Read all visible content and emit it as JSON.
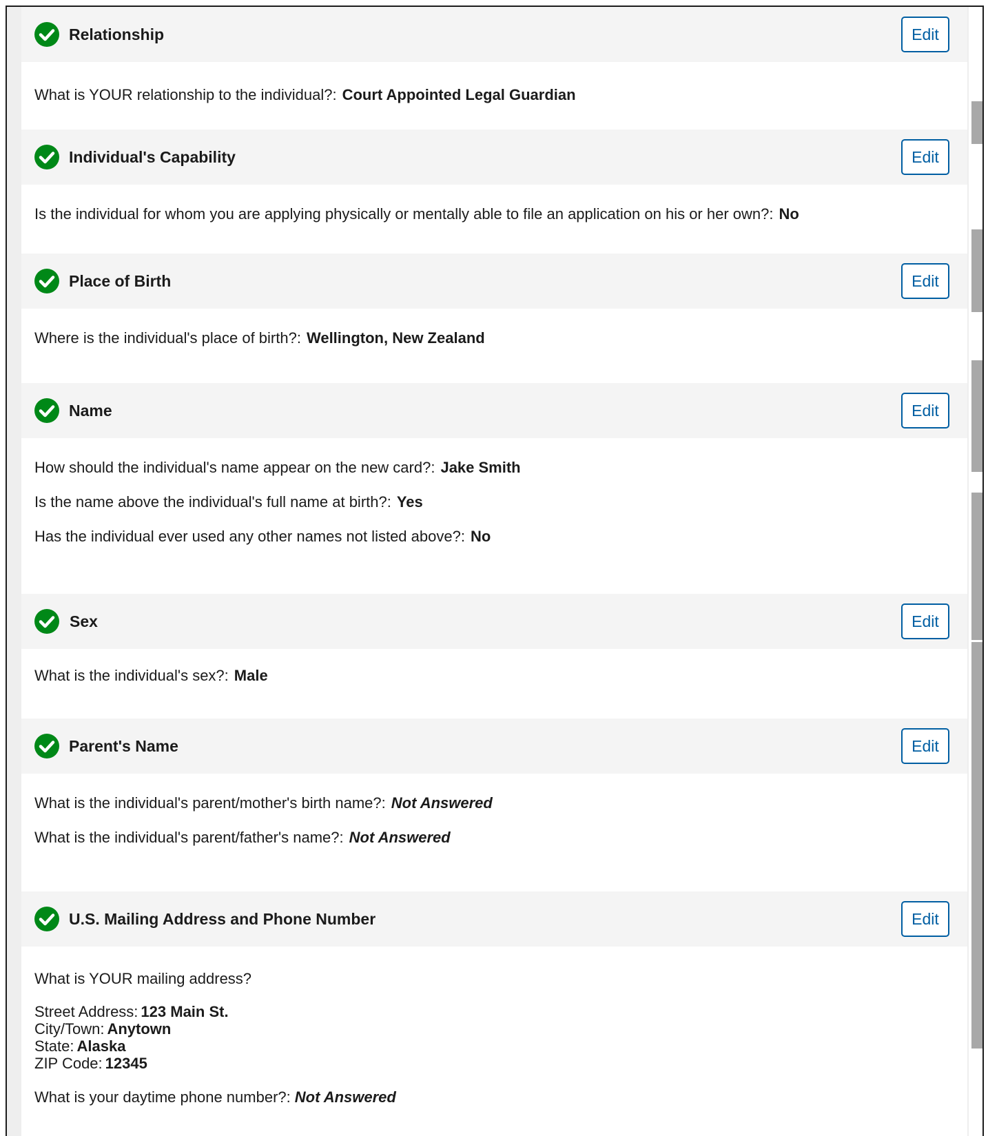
{
  "colors": {
    "check_green": "#008817",
    "edit_blue": "#005ea2",
    "header_bg": "#f4f4f4",
    "text": "#1b1b1b"
  },
  "sections": [
    {
      "title": "Relationship",
      "edit_label": "Edit",
      "icon": "check-circle-icon",
      "items": [
        {
          "q": "What is YOUR relationship to the individual?:",
          "a": "Court Appointed Legal Guardian"
        }
      ]
    },
    {
      "title": "Individual's Capability",
      "edit_label": "Edit",
      "icon": "check-circle-icon",
      "items": [
        {
          "q": "Is the individual for whom you are applying physically or mentally able to file an application on his or her own?:",
          "a": "No"
        }
      ]
    },
    {
      "title": "Place of Birth",
      "edit_label": "Edit",
      "icon": "check-circle-icon",
      "items": [
        {
          "q": "Where is the individual's place of birth?:",
          "a": "Wellington, New Zealand"
        }
      ]
    },
    {
      "title": "Name",
      "edit_label": "Edit",
      "icon": "check-circle-icon",
      "items": [
        {
          "q": "How should the individual's name appear on the new card?:",
          "a": "Jake Smith"
        },
        {
          "q": "Is the name above the individual's full name at birth?:",
          "a": "Yes"
        },
        {
          "q": "Has the individual ever used any other names not listed above?:",
          "a": "No"
        }
      ]
    },
    {
      "title": "Sex",
      "edit_label": "Edit",
      "icon": "check-circle-icon",
      "items": [
        {
          "q": "What is the individual's sex?:",
          "a": "Male"
        }
      ]
    },
    {
      "title": "Parent's Name",
      "edit_label": "Edit",
      "icon": "check-circle-icon",
      "items": [
        {
          "q": "What is the individual's parent/mother's birth name?:",
          "a": "Not Answered"
        },
        {
          "q": "What is the individual's parent/father's name?:",
          "a": "Not Answered"
        }
      ]
    },
    {
      "title": "U.S. Mailing Address and Phone Number",
      "edit_label": "Edit",
      "icon": "check-circle-icon",
      "mailing_question": "What is YOUR mailing address?",
      "address": {
        "street_label": "Street Address:",
        "street": "123 Main St.",
        "city_label": "City/Town:",
        "city": "Anytown",
        "state_label": "State:",
        "state": "Alaska",
        "zip_label": "ZIP Code:",
        "zip": "12345"
      },
      "phone_q": "What is your daytime phone number?:",
      "phone_a": "Not Answered"
    }
  ]
}
